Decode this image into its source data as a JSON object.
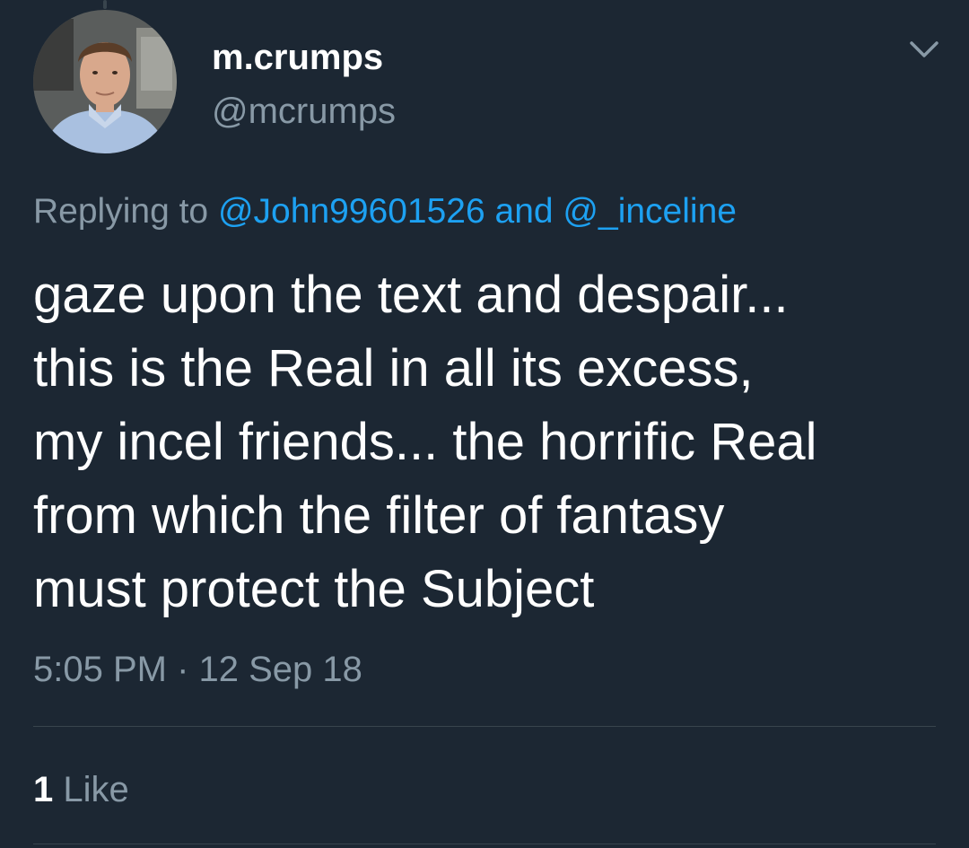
{
  "colors": {
    "background": "#1c2733",
    "primary_text": "#ffffff",
    "secondary_text": "#8899a6",
    "link": "#1da1f2",
    "divider": "#38444d"
  },
  "author": {
    "display_name": "m.crumps",
    "handle": "@mcrumps",
    "avatar_icon": "profile-photo"
  },
  "menu": {
    "icon": "chevron-down-icon"
  },
  "reply": {
    "prefix": "Replying to",
    "mentions": [
      "@John99601526",
      "@_inceline"
    ],
    "conjunction": "and"
  },
  "tweet": {
    "text": "gaze upon the text and despair...\nthis is the Real in all its excess,\nmy incel friends... the horrific Real\nfrom which the filter of fantasy\nmust protect the Subject",
    "timestamp": "5:05 PM · 12 Sep 18"
  },
  "stats": {
    "likes_count": "1",
    "likes_label": "Like"
  }
}
